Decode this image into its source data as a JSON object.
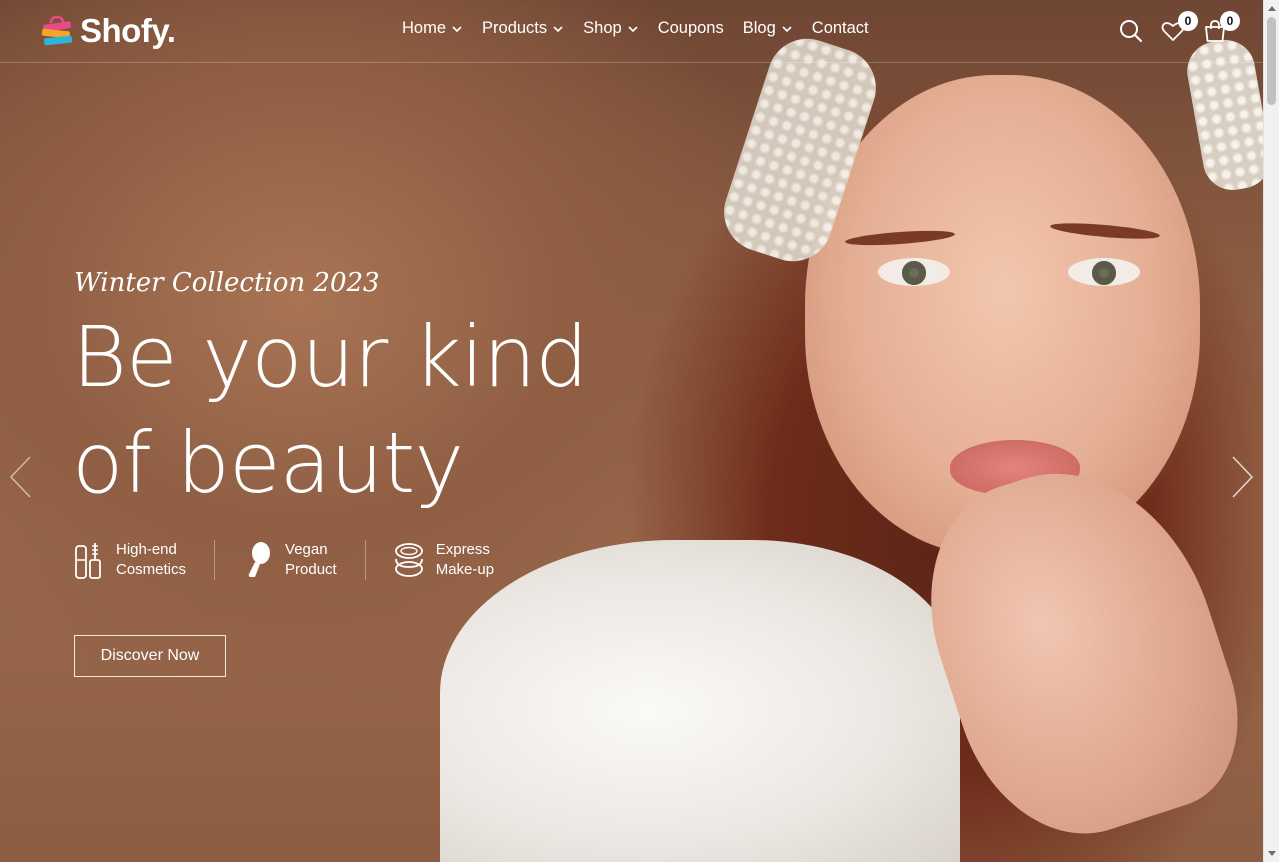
{
  "header": {
    "brand": "Shofy.",
    "nav": [
      {
        "label": "Home",
        "dropdown": true
      },
      {
        "label": "Products",
        "dropdown": true
      },
      {
        "label": "Shop",
        "dropdown": true
      },
      {
        "label": "Coupons",
        "dropdown": false
      },
      {
        "label": "Blog",
        "dropdown": true
      },
      {
        "label": "Contact",
        "dropdown": false
      }
    ],
    "wishlist_count": "0",
    "cart_count": "0"
  },
  "hero": {
    "subtitle": "Winter Collection 2023",
    "headline_line1": "Be your kind",
    "headline_line2": "of beauty",
    "features": [
      {
        "label": "High-end\nCosmetics",
        "icon": "cosmetics-icon"
      },
      {
        "label": "Vegan\nProduct",
        "icon": "vegan-icon"
      },
      {
        "label": "Express\nMake-up",
        "icon": "makeup-compact-icon"
      }
    ],
    "cta_label": "Discover Now"
  },
  "colors": {
    "text_on_hero": "#ffffff",
    "hero_bg": "#8a5c45",
    "logo_pink": "#e84a8a",
    "logo_orange": "#f4a62a",
    "logo_blue": "#2bb6d8"
  }
}
